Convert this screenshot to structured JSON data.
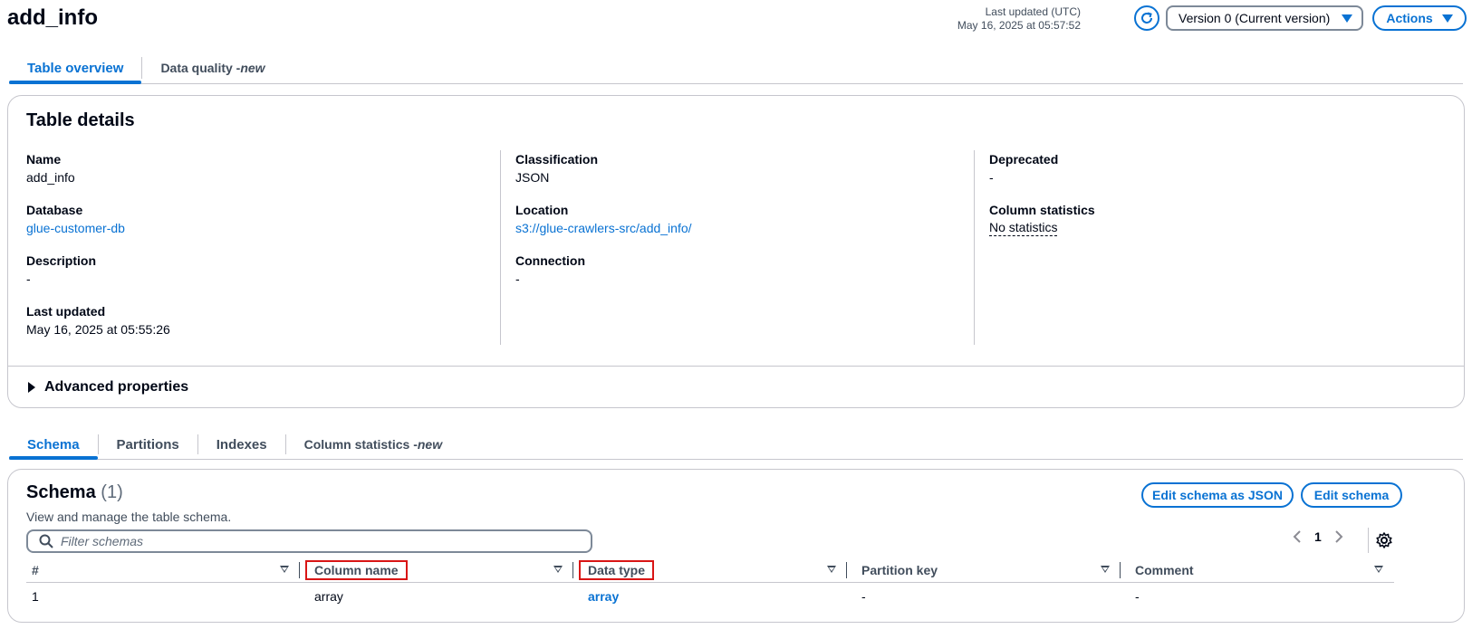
{
  "header": {
    "title": "add_info",
    "last_updated_label": "Last updated (UTC)",
    "last_updated_value": "May 16, 2025 at 05:57:52",
    "version": "Version 0 (Current version)",
    "actions": "Actions"
  },
  "top_tabs": [
    {
      "label": "Table overview",
      "suffix": ""
    },
    {
      "label": "Data quality - ",
      "suffix": "new"
    }
  ],
  "details": {
    "title": "Table details",
    "col1": [
      {
        "k": "Name",
        "v": "add_info"
      },
      {
        "k": "Database",
        "v": "glue-customer-db"
      },
      {
        "k": "Description",
        "v": "-"
      },
      {
        "k": "Last updated",
        "v": "May 16, 2025 at 05:55:26"
      }
    ],
    "col2": [
      {
        "k": "Classification",
        "v": "JSON"
      },
      {
        "k": "Location",
        "v": "s3://glue-crawlers-src/add_info/"
      },
      {
        "k": "Connection",
        "v": "-"
      }
    ],
    "col3": [
      {
        "k": "Deprecated",
        "v": "-"
      },
      {
        "k": "Column statistics",
        "v": "No statistics"
      }
    ],
    "advanced": "Advanced properties"
  },
  "schema_tabs": [
    {
      "label": "Schema",
      "suffix": ""
    },
    {
      "label": "Partitions",
      "suffix": ""
    },
    {
      "label": "Indexes",
      "suffix": ""
    },
    {
      "label": "Column statistics - ",
      "suffix": "new"
    }
  ],
  "schema": {
    "title": "Schema",
    "count": "(1)",
    "description": "View and manage the table schema.",
    "edit_json": "Edit schema as JSON",
    "edit": "Edit schema",
    "filter_placeholder": "Filter schemas",
    "page": "1",
    "columns": [
      "#",
      "Column name",
      "Data type",
      "Partition key",
      "Comment"
    ],
    "rows": [
      [
        "1",
        "array",
        "array",
        "-",
        "-"
      ]
    ]
  },
  "colors": {
    "accent": "#0972d3",
    "highlight": "#d91515"
  }
}
